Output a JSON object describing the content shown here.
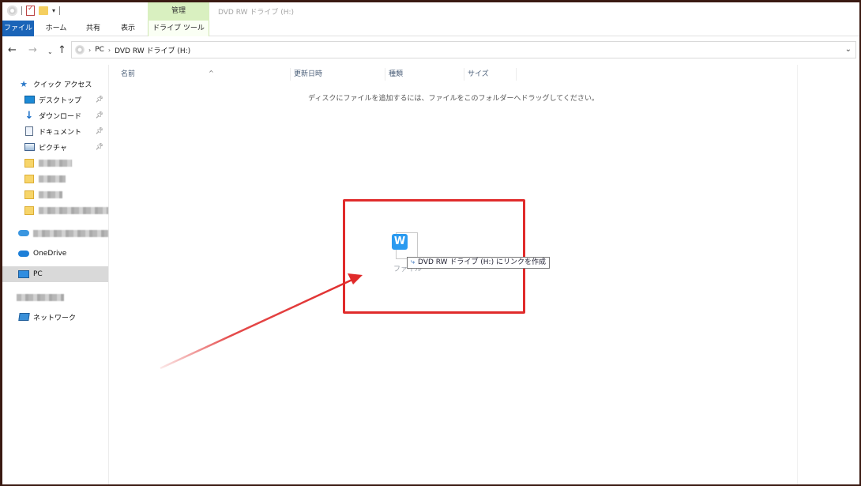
{
  "window": {
    "title": "DVD RW ドライブ (H:)",
    "context_tab_group": "管理"
  },
  "ribbon": {
    "tabs": [
      "ファイル",
      "ホーム",
      "共有",
      "表示",
      "ドライブ ツール"
    ]
  },
  "address": {
    "segments": [
      "PC",
      "DVD RW ドライブ (H:)"
    ]
  },
  "sidebar": {
    "quick_access": "クイック アクセス",
    "items": [
      "デスクトップ",
      "ダウンロード",
      "ドキュメント",
      "ピクチャ"
    ],
    "onedrive": "OneDrive",
    "pc": "PC",
    "network": "ネットワーク"
  },
  "columns": [
    "名前",
    "更新日時",
    "種類",
    "サイズ"
  ],
  "main": {
    "empty_message": "ディスクにファイルを追加するには、ファイルをこのフォルダーへドラッグしてください。"
  },
  "drag": {
    "file_label": "ファイル",
    "tooltip": "DVD RW ドライブ (H:) にリンクを作成"
  },
  "colors": {
    "accent": "#1a64b8",
    "context_tab": "#d9f0c0",
    "annotation": "#e02b2b"
  }
}
